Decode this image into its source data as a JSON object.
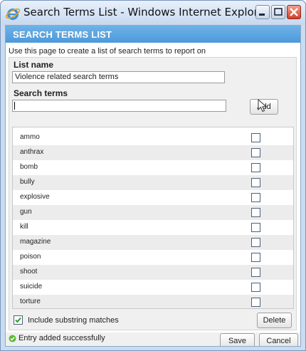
{
  "window": {
    "title": "Search Terms List - Windows Internet Explorer"
  },
  "header": {
    "title": "SEARCH TERMS LIST"
  },
  "intro": "Use this page to create a list of search terms to report on",
  "list_name": {
    "label": "List name",
    "value": "Violence related search terms"
  },
  "search_terms": {
    "label": "Search terms",
    "value": "",
    "add_label": "Add"
  },
  "terms": [
    {
      "term": "ammo",
      "checked": false
    },
    {
      "term": "anthrax",
      "checked": false
    },
    {
      "term": "bomb",
      "checked": false
    },
    {
      "term": "bully",
      "checked": false
    },
    {
      "term": "explosive",
      "checked": false
    },
    {
      "term": "gun",
      "checked": false
    },
    {
      "term": "kill",
      "checked": false
    },
    {
      "term": "magazine",
      "checked": false
    },
    {
      "term": "poison",
      "checked": false
    },
    {
      "term": "shoot",
      "checked": false
    },
    {
      "term": "suicide",
      "checked": false
    },
    {
      "term": "torture",
      "checked": false
    }
  ],
  "include_substring": {
    "label": "Include substring matches",
    "checked": true
  },
  "buttons": {
    "delete": "Delete",
    "save": "Save",
    "cancel": "Cancel"
  },
  "status": {
    "text": "Entry added successfully",
    "icon": "check-circle-icon"
  },
  "colors": {
    "header_bar": "#5aa6e0",
    "status_icon": "#5fb83a",
    "close_button": "#d33f25"
  }
}
